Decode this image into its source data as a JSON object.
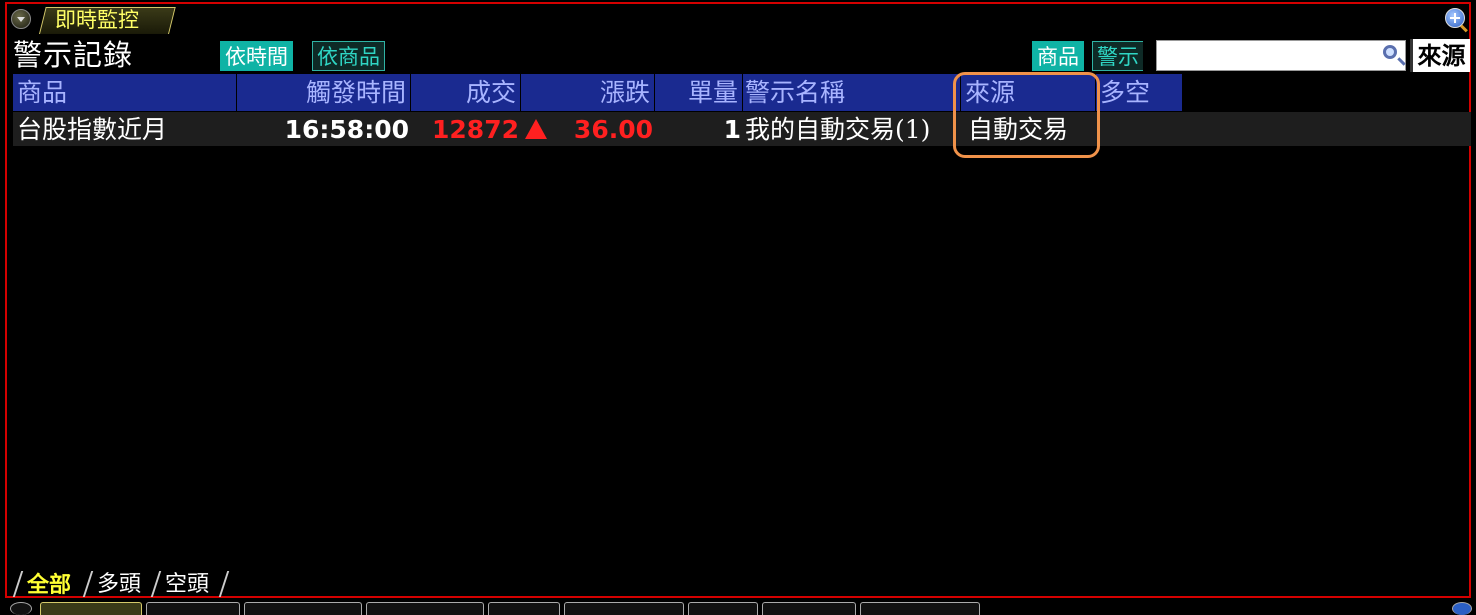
{
  "window": {
    "tab_label": "即時監控"
  },
  "toolbar": {
    "title": "警示記錄",
    "by_time_label": "依時間",
    "by_product_label": "依商品",
    "search_mode_product": "商品",
    "search_mode_alert": "警示",
    "search_value": "",
    "source_label": "來源"
  },
  "table": {
    "columns": [
      "商品",
      "觸發時間",
      "成交",
      "漲跌",
      "單量",
      "警示名稱",
      "來源",
      "多空"
    ],
    "rows": [
      {
        "product": "台股指數近月",
        "trigger_time": "16:58:00",
        "price": "12872",
        "change": "36.00",
        "volume": "1",
        "alert_name": "我的自動交易(1)",
        "source": "自動交易",
        "direction": ""
      }
    ]
  },
  "bottom_tabs": [
    "全部",
    "多頭",
    "空頭"
  ],
  "colors": {
    "frame_border": "#d40000",
    "header_bg": "#1a2a90",
    "header_text": "#a8b4ff",
    "up_red": "#ff2020",
    "teal": "#0fb3a5",
    "highlight": "#f0924a",
    "active_tab": "#ffff33"
  }
}
